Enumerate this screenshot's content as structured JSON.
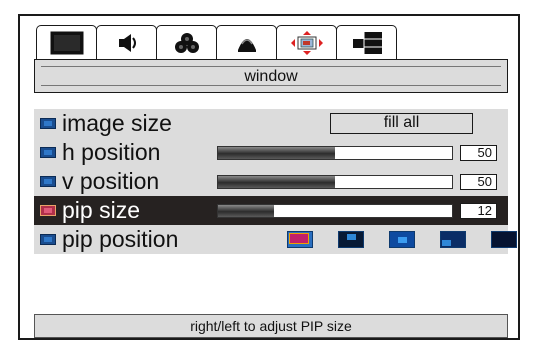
{
  "tabs": [
    {
      "icon": "picture-icon",
      "active": false
    },
    {
      "icon": "speaker-icon",
      "active": false
    },
    {
      "icon": "color-icon",
      "active": false
    },
    {
      "icon": "channel-icon",
      "active": false
    },
    {
      "icon": "window-settings-icon",
      "active": true
    },
    {
      "icon": "pip-icon",
      "active": false
    }
  ],
  "section_title": "window",
  "rows": {
    "image_size": {
      "label": "image size",
      "value": "fill all"
    },
    "h_position": {
      "label": "h position",
      "value": "50",
      "level": 0.5
    },
    "v_position": {
      "label": "v position",
      "value": "50",
      "level": 0.5
    },
    "pip_size": {
      "label": "pip size",
      "value": "12",
      "level": 0.24,
      "selected": true
    },
    "pip_position": {
      "label": "pip position",
      "options": [
        "top-left",
        "top-center",
        "center",
        "bottom-left",
        "none"
      ],
      "selected_option": "top-left"
    }
  },
  "status_text": "right/left to adjust PIP size",
  "colors": {
    "menu_bg": "#dcdcdc",
    "selected_row": "#262221",
    "accent_blue": "#1a4d8f"
  }
}
